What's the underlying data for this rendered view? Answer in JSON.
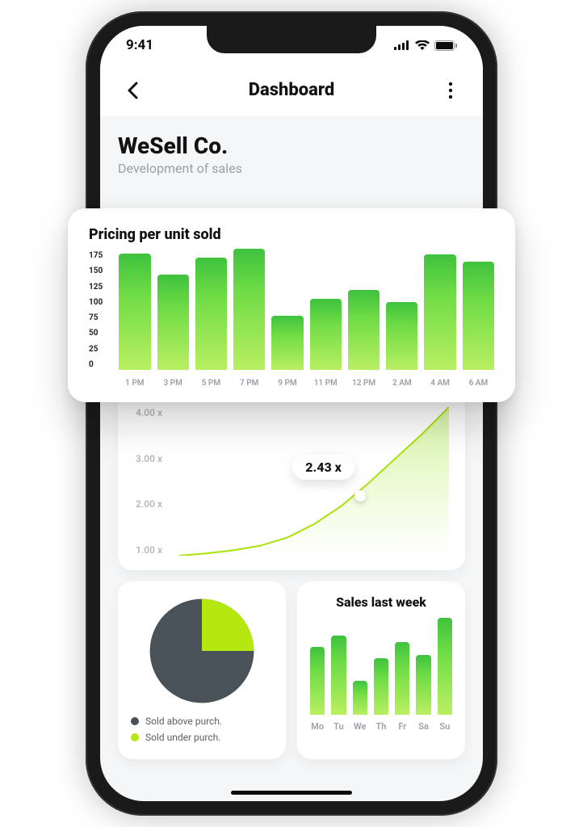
{
  "status": {
    "time": "9:41"
  },
  "nav": {
    "title": "Dashboard"
  },
  "company": {
    "name": "WeSell Co.",
    "subtitle": "Development of sales"
  },
  "pricing": {
    "title": "Pricing per unit sold",
    "y_ticks": [
      "175",
      "150",
      "125",
      "100",
      "75",
      "50",
      "25",
      "0"
    ],
    "x_ticks": [
      "1 PM",
      "3 PM",
      "5 PM",
      "7 PM",
      "9 PM",
      "11 PM",
      "12 PM",
      "2 AM",
      "4 AM",
      "6 AM"
    ]
  },
  "area": {
    "y_ticks": [
      "4.00 x",
      "3.00 x",
      "2.00 x",
      "1.00 x"
    ],
    "marker_label": "2.43 x"
  },
  "pie": {
    "legend_above": "Sold above purch.",
    "legend_under": "Sold under purch."
  },
  "week": {
    "title": "Sales last week",
    "x_ticks": [
      "Mo",
      "Tu",
      "We",
      "Th",
      "Fr",
      "Sa",
      "Su"
    ]
  },
  "colors": {
    "green_top": "#3fc23f",
    "green_bottom": "#b9ef62",
    "lime": "#b4e80f",
    "slate": "#495159"
  },
  "chart_data": [
    {
      "type": "bar",
      "title": "Pricing per unit sold",
      "categories": [
        "1 PM",
        "3 PM",
        "5 PM",
        "7 PM",
        "9 PM",
        "11 PM",
        "12 PM",
        "2 AM",
        "4 AM",
        "6 AM"
      ],
      "values": [
        172,
        140,
        165,
        178,
        80,
        105,
        118,
        100,
        170,
        160
      ],
      "ylabel": "",
      "xlabel": "",
      "ylim": [
        0,
        175
      ]
    },
    {
      "type": "area",
      "title": "",
      "x": [
        0,
        0.1,
        0.2,
        0.3,
        0.4,
        0.5,
        0.6,
        0.7,
        0.8,
        0.9,
        1.0
      ],
      "y": [
        1.0,
        1.05,
        1.12,
        1.22,
        1.4,
        1.7,
        2.1,
        2.6,
        3.15,
        3.7,
        4.3
      ],
      "marker": {
        "x": 0.66,
        "y": 2.43,
        "label": "2.43 x"
      },
      "ylabel": "",
      "ylim": [
        1.0,
        4.3
      ]
    },
    {
      "type": "pie",
      "title": "",
      "series": [
        {
          "name": "Sold above purch.",
          "value": 75,
          "color": "#495159"
        },
        {
          "name": "Sold under purch.",
          "value": 25,
          "color": "#b4e80f"
        }
      ]
    },
    {
      "type": "bar",
      "title": "Sales last week",
      "categories": [
        "Mo",
        "Tu",
        "We",
        "Th",
        "Fr",
        "Sa",
        "Su"
      ],
      "values": [
        70,
        82,
        35,
        58,
        75,
        62,
        100
      ],
      "ylim": [
        0,
        100
      ]
    }
  ]
}
